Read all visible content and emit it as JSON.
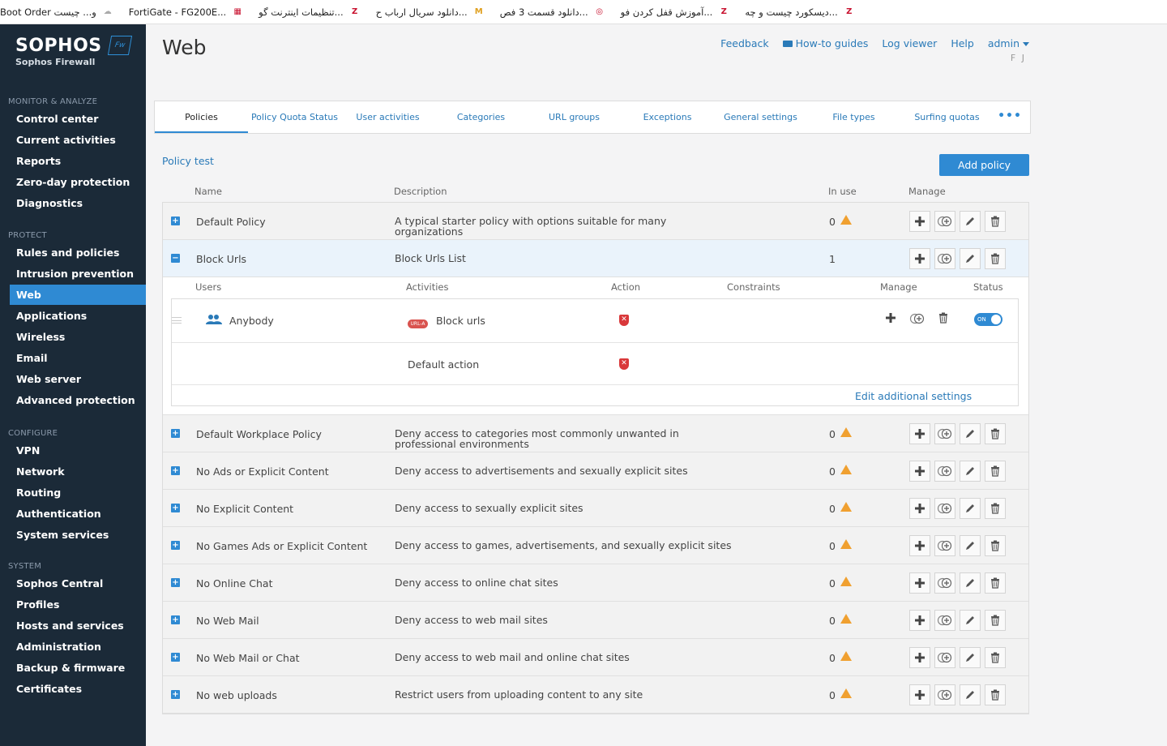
{
  "bookmarks": [
    {
      "label": "دیسکورد چیست و چه...",
      "icon": "z-icon",
      "color": "#c8102e"
    },
    {
      "label": "آموزش قفل کردن فو...",
      "icon": "z-icon",
      "color": "#c8102e"
    },
    {
      "label": "دانلود قسمت 3 فص...",
      "icon": "target-icon",
      "color": "#c8102e"
    },
    {
      "label": "دانلود سریال ارباب ح...",
      "icon": "m-icon",
      "color": "#e0a020"
    },
    {
      "label": "تنظیمات اینترنت گو...",
      "icon": "z-icon",
      "color": "#c8102e"
    },
    {
      "label": "FortiGate - FG200E...",
      "icon": "fortinet-icon",
      "color": "#c8102e"
    },
    {
      "label": "Boot Order و... چیست",
      "icon": "cloud-icon",
      "color": "#aaaaaa"
    }
  ],
  "sidebar": {
    "logo": "SOPHOS",
    "logo_badge": "Fw",
    "product": "Sophos Firewall",
    "sections": [
      {
        "title": "MONITOR & ANALYZE",
        "items": [
          "Control center",
          "Current activities",
          "Reports",
          "Zero-day protection",
          "Diagnostics"
        ]
      },
      {
        "title": "PROTECT",
        "items": [
          "Rules and policies",
          "Intrusion prevention",
          "Web",
          "Applications",
          "Wireless",
          "Email",
          "Web server",
          "Advanced protection"
        ]
      },
      {
        "title": "CONFIGURE",
        "items": [
          "VPN",
          "Network",
          "Routing",
          "Authentication",
          "System services"
        ]
      },
      {
        "title": "SYSTEM",
        "items": [
          "Sophos Central",
          "Profiles",
          "Hosts and services",
          "Administration",
          "Backup & firmware",
          "Certificates"
        ]
      }
    ],
    "active": "Web"
  },
  "header": {
    "title": "Web",
    "links": [
      "Feedback",
      "How-to guides",
      "Log viewer",
      "Help",
      "admin"
    ],
    "user_initials": "F J"
  },
  "tabs": [
    "Policies",
    "Policy Quota Status",
    "User activities",
    "Categories",
    "URL groups",
    "Exceptions",
    "General settings",
    "File types",
    "Surfing quotas"
  ],
  "tabs_more": "•••",
  "policy_test": "Policy test",
  "add_policy": "Add policy",
  "columns": {
    "name": "Name",
    "description": "Description",
    "in_use": "In use",
    "manage": "Manage"
  },
  "policies": [
    {
      "name": "Default Policy",
      "description": "A typical starter policy with options suitable for many organizations",
      "in_use": "0",
      "warn": true
    },
    {
      "name": "Block Urls",
      "description": "Block Urls List",
      "in_use": "1",
      "warn": false,
      "expanded": true
    },
    {
      "name": "Default Workplace Policy",
      "description": "Deny access to categories most commonly unwanted in professional environments",
      "in_use": "0",
      "warn": true
    },
    {
      "name": "No Ads or Explicit Content",
      "description": "Deny access to advertisements and sexually explicit sites",
      "in_use": "0",
      "warn": true
    },
    {
      "name": "No Explicit Content",
      "description": "Deny access to sexually explicit sites",
      "in_use": "0",
      "warn": true
    },
    {
      "name": "No Games Ads or Explicit Content",
      "description": "Deny access to games, advertisements, and sexually explicit sites",
      "in_use": "0",
      "warn": true
    },
    {
      "name": "No Online Chat",
      "description": "Deny access to online chat sites",
      "in_use": "0",
      "warn": true
    },
    {
      "name": "No Web Mail",
      "description": "Deny access to web mail sites",
      "in_use": "0",
      "warn": true
    },
    {
      "name": "No Web Mail or Chat",
      "description": "Deny access to web mail and online chat sites",
      "in_use": "0",
      "warn": true
    },
    {
      "name": "No web uploads",
      "description": "Restrict users from uploading content to any site",
      "in_use": "0",
      "warn": true
    }
  ],
  "rule_columns": {
    "users": "Users",
    "activities": "Activities",
    "action": "Action",
    "constraints": "Constraints",
    "manage": "Manage",
    "status": "Status"
  },
  "rule": {
    "users": "Anybody",
    "activity": "Block urls",
    "activity_badge": "URL-A",
    "status": "ON"
  },
  "default_action": "Default action",
  "edit_additional": "Edit additional settings",
  "colors": {
    "sidebar": "#1b2a38",
    "accent": "#2f8ad3",
    "link": "#2a7ab8",
    "warn": "#f0a030",
    "block": "#d9383a"
  }
}
